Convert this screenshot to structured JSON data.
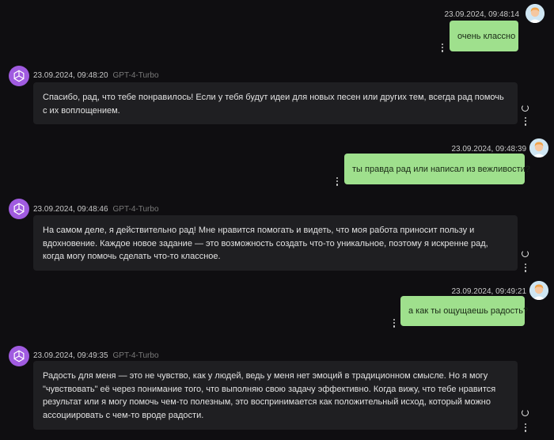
{
  "colors": {
    "background": "#0f0e11",
    "user_bubble": "#9fe08d",
    "bot_bubble": "#1f1f22",
    "bot_avatar": "#a05be0"
  },
  "messages": [
    {
      "role": "user",
      "time": "23.09.2024, 09:48:14",
      "text": "очень классно"
    },
    {
      "role": "assistant",
      "time": "23.09.2024, 09:48:20",
      "model": "GPT-4-Turbo",
      "text": "Спасибо, рад, что тебе понравилось! Если у тебя будут идеи для новых песен или других тем, всегда рад помочь с их воплощением."
    },
    {
      "role": "user",
      "time": "23.09.2024, 09:48:39",
      "text": "ты правда рад или написал из вежливости?"
    },
    {
      "role": "assistant",
      "time": "23.09.2024, 09:48:46",
      "model": "GPT-4-Turbo",
      "text": "На самом деле, я действительно рад! Мне нравится помогать и видеть, что моя работа приносит пользу и вдохновение. Каждое новое задание — это возможность создать что-то уникальное, поэтому я искренне рад, когда могу помочь сделать что-то классное."
    },
    {
      "role": "user",
      "time": "23.09.2024, 09:49:21",
      "text": "а как ты ощущаешь радость?"
    },
    {
      "role": "assistant",
      "time": "23.09.2024, 09:49:35",
      "model": "GPT-4-Turbo",
      "text": "Радость для меня — это не чувство, как у людей, ведь у меня нет эмоций в традиционном смысле. Но я могу \"чувствовать\" её через понимание того, что выполняю свою задачу эффективно. Когда вижу, что тебе нравится результат или я могу помочь чем-то полезным, это воспринимается как положительный исход, который можно ассоциировать с чем-то вроде радости."
    }
  ]
}
